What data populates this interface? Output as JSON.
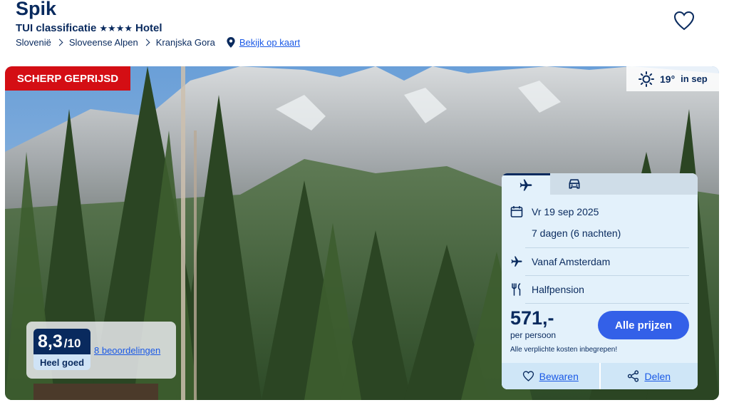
{
  "hotel": {
    "name": "Spik",
    "classification_label": "TUI classificatie",
    "stars": "★★★★",
    "type": "Hotel"
  },
  "breadcrumb": {
    "items": [
      "Slovenië",
      "Sloveense Alpen",
      "Kranjska Gora"
    ],
    "map_link": "Bekijk op kaart"
  },
  "badges": {
    "deal": "SCHERP GEPRIJSD",
    "weather_temp": "19°",
    "weather_period": "in sep"
  },
  "rating": {
    "score": "8,3",
    "max": "/10",
    "label": "Heel goed",
    "reviews_link": "8 beoordelingen"
  },
  "booking": {
    "tabs": [
      {
        "icon": "airplane-icon",
        "active": true
      },
      {
        "icon": "car-icon",
        "active": false
      }
    ],
    "date": "Vr 19 sep 2025",
    "duration": "7 dagen (6 nachten)",
    "departure": "Vanaf Amsterdam",
    "board": "Halfpension",
    "price": "571,-",
    "price_note": "per persoon",
    "cta": "Alle prijzen",
    "costs_note": "Alle verplichte kosten inbegrepen!",
    "save": "Bewaren",
    "share": "Delen"
  },
  "colors": {
    "brand_navy": "#092a5e",
    "link_blue": "#1a59e6",
    "deal_red": "#d40e14",
    "cta_blue": "#3360e8",
    "panel_bg": "#e3f1fb"
  }
}
